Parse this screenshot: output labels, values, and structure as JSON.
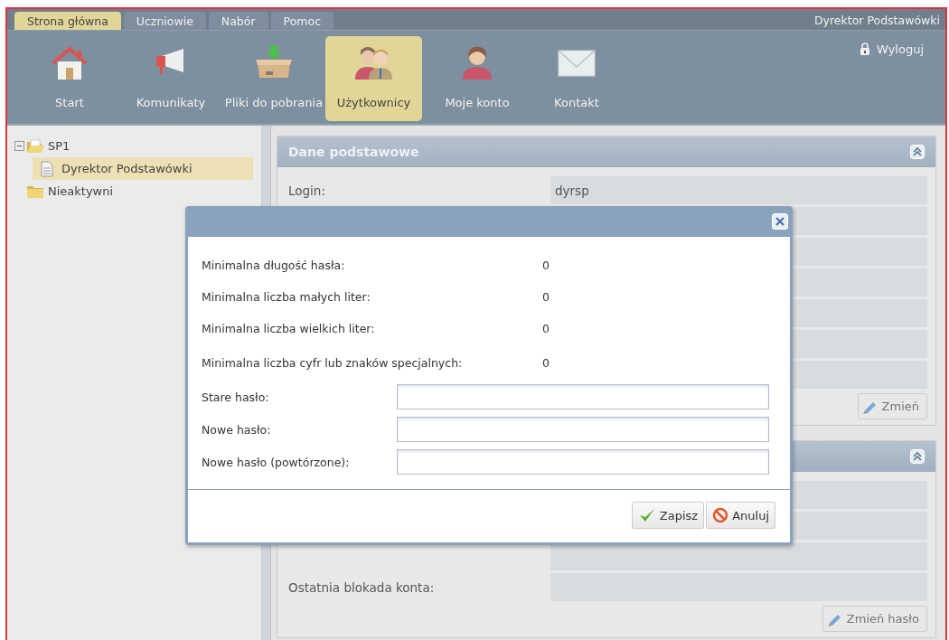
{
  "top_tabs": [
    {
      "label": "Strona główna",
      "selected": true
    },
    {
      "label": "Uczniowie",
      "selected": false
    },
    {
      "label": "Nabór",
      "selected": false
    },
    {
      "label": "Pomoc",
      "selected": false
    }
  ],
  "user_name": "Dyrektor Podstawówki",
  "toolbar": [
    {
      "label": "Start",
      "kind": "home",
      "selected": false
    },
    {
      "label": "Komunikaty",
      "kind": "megaphone",
      "selected": false
    },
    {
      "label": "Pliki do pobrania",
      "kind": "box",
      "selected": false
    },
    {
      "label": "Użytkownicy",
      "kind": "people",
      "selected": true
    },
    {
      "label": "Moje konto",
      "kind": "person",
      "selected": false
    },
    {
      "label": "Kontakt",
      "kind": "envelope",
      "selected": false
    }
  ],
  "logout": "Wyloguj",
  "tree": [
    {
      "label": "SP1",
      "expanded": true,
      "selected": false,
      "children": [
        {
          "label": "Dyrektor Podstawówki",
          "selected": true
        }
      ]
    },
    {
      "label": "Nieaktywni",
      "selected": false
    }
  ],
  "panels": [
    {
      "title": "Dane podstawowe",
      "rows": [
        {
          "kind": "field",
          "label": "Login:",
          "value": "dyrsp"
        },
        {
          "kind": "covered"
        },
        {
          "kind": "covered"
        },
        {
          "kind": "covered"
        },
        {
          "kind": "covered"
        },
        {
          "kind": "covered"
        },
        {
          "kind": "covered"
        }
      ],
      "button": "Zmień"
    },
    {
      "rows": [
        {
          "kind": "covered"
        },
        {
          "kind": "covered"
        },
        {
          "kind": "covered"
        },
        {
          "kind": "field",
          "label": "Ostatnia blokada konta:"
        }
      ],
      "button": "Zmień hasło"
    }
  ],
  "dialog": {
    "rules": [
      {
        "label": "Minimalna długość hasła:",
        "value": "0"
      },
      {
        "label": "Minimalna liczba małych liter:",
        "value": "0"
      },
      {
        "label": "Minimalna liczba wielkich liter:",
        "value": "0"
      },
      {
        "label": "Minimalna liczba cyfr lub znaków specjalnych:",
        "value": "0"
      }
    ],
    "fields": [
      {
        "label": "Stare hasło:"
      },
      {
        "label": "Nowe hasło:"
      },
      {
        "label": "Nowe hasło (powtórzone):"
      }
    ],
    "buttons": [
      {
        "label": "Zapisz",
        "kind": "save"
      },
      {
        "label": "Anuluj",
        "kind": "cancel"
      }
    ]
  }
}
